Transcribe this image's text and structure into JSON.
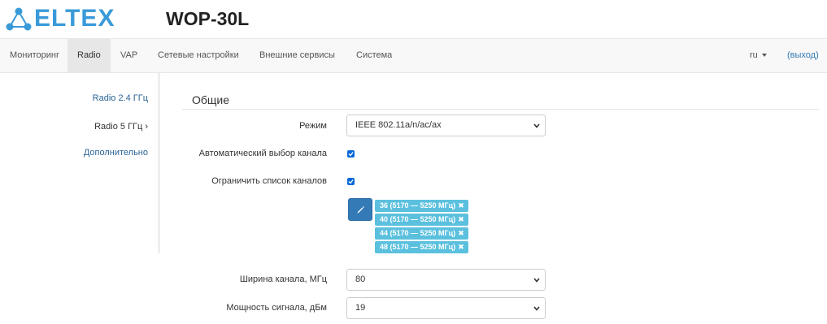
{
  "header": {
    "logo_text": "ELTEX",
    "model": "WOP-30L"
  },
  "nav": {
    "items": [
      {
        "label": "Мониторинг"
      },
      {
        "label": "Radio"
      },
      {
        "label": "VAP"
      },
      {
        "label": "Сетевые настройки"
      },
      {
        "label": "Внешние сервисы"
      },
      {
        "label": "Система"
      }
    ],
    "active": "Radio",
    "lang": "ru",
    "logout": "(выход)"
  },
  "sidebar": {
    "items": [
      {
        "label": "Radio 2.4 ГГц"
      },
      {
        "label": "Radio 5 ГГц ›"
      },
      {
        "label": "Дополнительно"
      }
    ]
  },
  "section": {
    "title": "Общие"
  },
  "form": {
    "mode_label": "Режим",
    "mode_value": "IEEE 802.11a/n/ac/ax",
    "auto_channel_label": "Автоматический выбор канала",
    "auto_channel_checked": true,
    "limit_channels_label": "Ограничить список каналов",
    "limit_channels_checked": true,
    "channels": [
      "36 (5170 — 5250 МГц)",
      "40 (5170 — 5250 МГц)",
      "44 (5170 — 5250 МГц)",
      "48 (5170 — 5250 МГц)"
    ],
    "bandwidth_label": "Ширина канала, МГц",
    "bandwidth_value": "80",
    "power_label": "Мощность сигнала, дБм",
    "power_value": "19"
  },
  "colors": {
    "brand": "#3a9ad9",
    "link": "#337ab7",
    "tag": "#5bc0de",
    "checkbox": "#0b68d8"
  }
}
